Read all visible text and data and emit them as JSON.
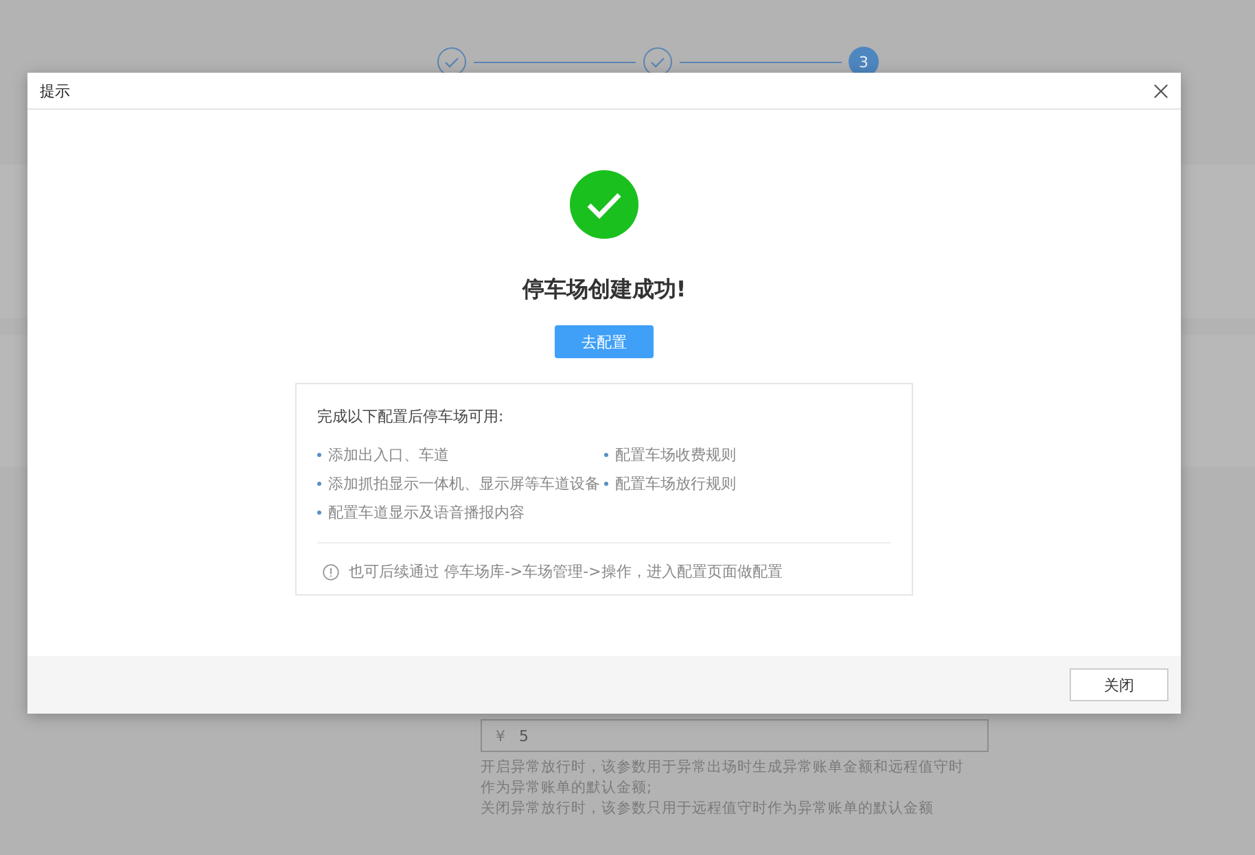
{
  "steps": [
    {
      "done": true
    },
    {
      "done": true
    },
    {
      "done": false,
      "number": "3"
    }
  ],
  "field": {
    "currency": "¥",
    "value": "5",
    "help": [
      "开启异常放行时，该参数用于异常出场时生成异常账单金额和远程值守时作为异常账单的默认金额;",
      "关闭异常放行时，该参数只用于远程值守时作为异常账单的默认金额"
    ]
  },
  "dialog": {
    "title": "提示",
    "message": "停车场创建成功!",
    "primary_button": "去配置",
    "info": {
      "heading": "完成以下配置后停车场可用:",
      "items": [
        "添加出入口、车道",
        "配置车场收费规则",
        "添加抓拍显示一体机、显示屏等车道设备",
        "配置车场放行规则",
        "配置车道显示及语音播报内容"
      ],
      "note": "也可后续通过 停车场库->车场管理->操作，进入配置页面做配置"
    },
    "close_button": "关闭"
  }
}
